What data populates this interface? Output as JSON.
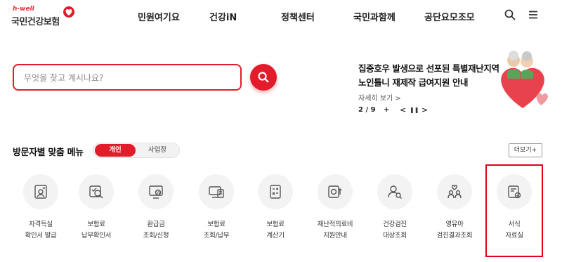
{
  "header": {
    "logo": {
      "sub": "h-well",
      "main": "국민건강보험"
    },
    "nav": [
      {
        "label": "민원여기요"
      },
      {
        "label": "건강iN"
      },
      {
        "label": "정책센터"
      },
      {
        "label": "국민과함께"
      },
      {
        "label": "공단요모조모"
      }
    ],
    "icons": {
      "search": "search-icon",
      "menu": "hamburger-menu-icon"
    }
  },
  "search": {
    "placeholder": "무엇을 찾고 계시나요?",
    "value": "",
    "button_icon": "search-icon"
  },
  "notice": {
    "title": "집중호우 발생으로 선포된 특별재난지역 노인틀니 재제작 급여지원 안내",
    "more_label": "자세히 보기 >",
    "pager": {
      "current": 2,
      "total": 9,
      "text": "2 / 9",
      "plus": "+"
    },
    "controls": {
      "prev": "<",
      "pause": "❚❚",
      "next": ">"
    }
  },
  "section": {
    "title": "방문자별 맞춤 메뉴",
    "toggle": {
      "active": "개인",
      "inactive": "사업장"
    },
    "more_button": "더보기+"
  },
  "menu": [
    {
      "label": "자격득실\n확인서 발급",
      "icon": "id-card-heart-icon"
    },
    {
      "label": "보험료\n납부확인서",
      "icon": "document-search-icon"
    },
    {
      "label": "환급금\n조회/신청",
      "icon": "monitor-won-icon"
    },
    {
      "label": "보험료\n조회/납부",
      "icon": "computer-bill-icon"
    },
    {
      "label": "보험료\n계산기",
      "icon": "calculator-icon"
    },
    {
      "label": "재난적의료비\n지원안내",
      "icon": "card-won-up-icon"
    },
    {
      "label": "건강검진\n대상조회",
      "icon": "person-search-icon"
    },
    {
      "label": "영유아\n검진결과조회",
      "icon": "family-heart-icon"
    },
    {
      "label": "서식\n자료실",
      "icon": "form-document-check-icon"
    }
  ],
  "colors": {
    "accent": "#e21c2a",
    "highlight": "#e2001a"
  }
}
